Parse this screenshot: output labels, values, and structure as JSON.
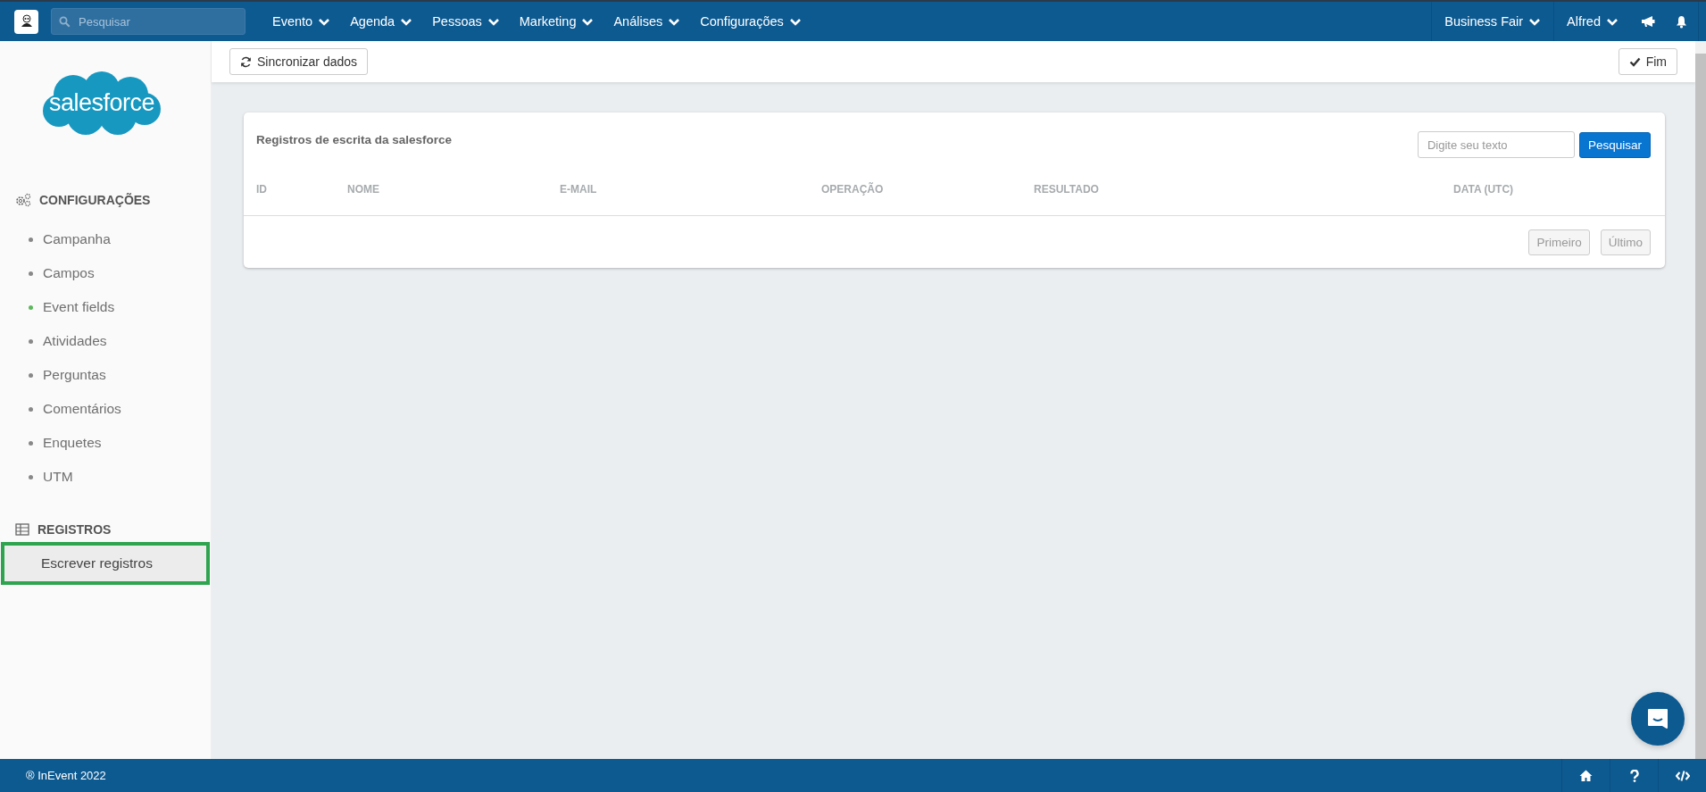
{
  "topbar": {
    "search": {
      "placeholder": "Pesquisar"
    },
    "menu": [
      {
        "label": "Evento"
      },
      {
        "label": "Agenda"
      },
      {
        "label": "Pessoas"
      },
      {
        "label": "Marketing"
      },
      {
        "label": "Análises"
      },
      {
        "label": "Configurações"
      }
    ],
    "right_menu": [
      {
        "label": "Business Fair"
      },
      {
        "label": "Alfred"
      }
    ]
  },
  "sidebar": {
    "logo_text": "salesforce",
    "sections": [
      {
        "kind": "settings",
        "title": "CONFIGURAÇÕES",
        "items": [
          {
            "label": "Campanha",
            "selected": false,
            "color": "#888888"
          },
          {
            "label": "Campos",
            "selected": false,
            "color": "#888888"
          },
          {
            "label": "Event fields",
            "selected": false,
            "color": "#5cb85c"
          },
          {
            "label": "Atividades",
            "selected": false,
            "color": "#888888"
          },
          {
            "label": "Perguntas",
            "selected": false,
            "color": "#888888"
          },
          {
            "label": "Comentários",
            "selected": false,
            "color": "#888888"
          },
          {
            "label": "Enquetes",
            "selected": false,
            "color": "#888888"
          },
          {
            "label": "UTM",
            "selected": false,
            "color": "#888888"
          }
        ]
      },
      {
        "kind": "table",
        "title": "REGISTROS",
        "items": [
          {
            "label": "Escrever registros",
            "selected": true,
            "highlighted": true
          }
        ]
      }
    ]
  },
  "toolbar": {
    "sync_button": "Sincronizar dados",
    "done_button": "Fim"
  },
  "card": {
    "title": "Registros de escrita da salesforce",
    "search": {
      "placeholder": "Digite seu texto"
    },
    "search_button": "Pesquisar",
    "table": {
      "columns": [
        "ID",
        "NOME",
        "E-MAIL",
        "OPERAÇÃO",
        "RESULTADO",
        "DATA (UTC)"
      ]
    },
    "pagination": [
      {
        "label": "Primeiro",
        "disabled": true
      },
      {
        "label": "Último",
        "disabled": true
      }
    ]
  },
  "footer": {
    "copyright": "® InEvent 2022"
  }
}
